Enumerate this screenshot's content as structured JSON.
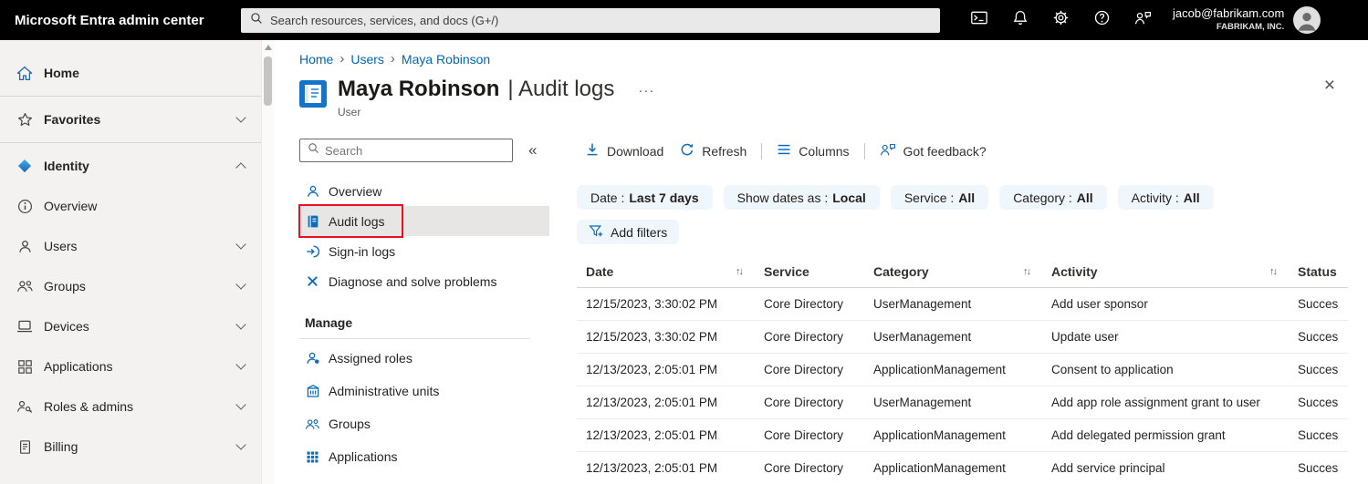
{
  "glyphs": {
    "collapse": "«",
    "crumb_sep": "›",
    "ellipsis": "···",
    "close": "×",
    "sort": "↑↓"
  },
  "colors": {
    "accent": "#0f6cbd",
    "topbar_bg": "#000000",
    "link": "#0067b8",
    "pill_bg": "#eff6fc",
    "highlight_red": "#e81123",
    "sidebar_bg": "#f3f2f1"
  },
  "topbar": {
    "title": "Microsoft Entra admin center",
    "search_placeholder": "Search resources, services, and docs (G+/)",
    "account": {
      "email": "jacob@fabrikam.com",
      "org": "FABRIKAM, INC."
    }
  },
  "sidebar": {
    "items": [
      {
        "label": "Home"
      },
      {
        "label": "Favorites"
      },
      {
        "label": "Identity"
      },
      {
        "label": "Overview"
      },
      {
        "label": "Users"
      },
      {
        "label": "Groups"
      },
      {
        "label": "Devices"
      },
      {
        "label": "Applications"
      },
      {
        "label": "Roles & admins"
      },
      {
        "label": "Billing"
      }
    ]
  },
  "breadcrumb": {
    "items": [
      "Home",
      "Users",
      "Maya Robinson"
    ]
  },
  "page": {
    "name": "Maya Robinson",
    "section": "| Audit logs",
    "subtitle": "User"
  },
  "inner_nav": {
    "search_placeholder": "Search",
    "items": [
      "Overview",
      "Audit logs",
      "Sign-in logs",
      "Diagnose and solve problems"
    ],
    "section_header": "Manage",
    "manage_items": [
      "Assigned roles",
      "Administrative units",
      "Groups",
      "Applications"
    ]
  },
  "toolbar": {
    "download": "Download",
    "refresh": "Refresh",
    "columns": "Columns",
    "feedback": "Got feedback?"
  },
  "filters": {
    "pills": [
      {
        "label": "Date :",
        "value": "Last 7 days"
      },
      {
        "label": "Show dates as :",
        "value": "Local"
      },
      {
        "label": "Service :",
        "value": "All"
      },
      {
        "label": "Category :",
        "value": "All"
      },
      {
        "label": "Activity :",
        "value": "All"
      }
    ],
    "add": "Add filters"
  },
  "table": {
    "headers": [
      "Date",
      "Service",
      "Category",
      "Activity",
      "Status"
    ],
    "rows": [
      {
        "date": "12/15/2023, 3:30:02 PM",
        "service": "Core Directory",
        "category": "UserManagement",
        "activity": "Add user sponsor",
        "status": "Succes"
      },
      {
        "date": "12/15/2023, 3:30:02 PM",
        "service": "Core Directory",
        "category": "UserManagement",
        "activity": "Update user",
        "status": "Succes"
      },
      {
        "date": "12/13/2023, 2:05:01 PM",
        "service": "Core Directory",
        "category": "ApplicationManagement",
        "activity": "Consent to application",
        "status": "Succes"
      },
      {
        "date": "12/13/2023, 2:05:01 PM",
        "service": "Core Directory",
        "category": "UserManagement",
        "activity": "Add app role assignment grant to user",
        "status": "Succes"
      },
      {
        "date": "12/13/2023, 2:05:01 PM",
        "service": "Core Directory",
        "category": "ApplicationManagement",
        "activity": "Add delegated permission grant",
        "status": "Succes"
      },
      {
        "date": "12/13/2023, 2:05:01 PM",
        "service": "Core Directory",
        "category": "ApplicationManagement",
        "activity": "Add service principal",
        "status": "Succes"
      }
    ]
  }
}
